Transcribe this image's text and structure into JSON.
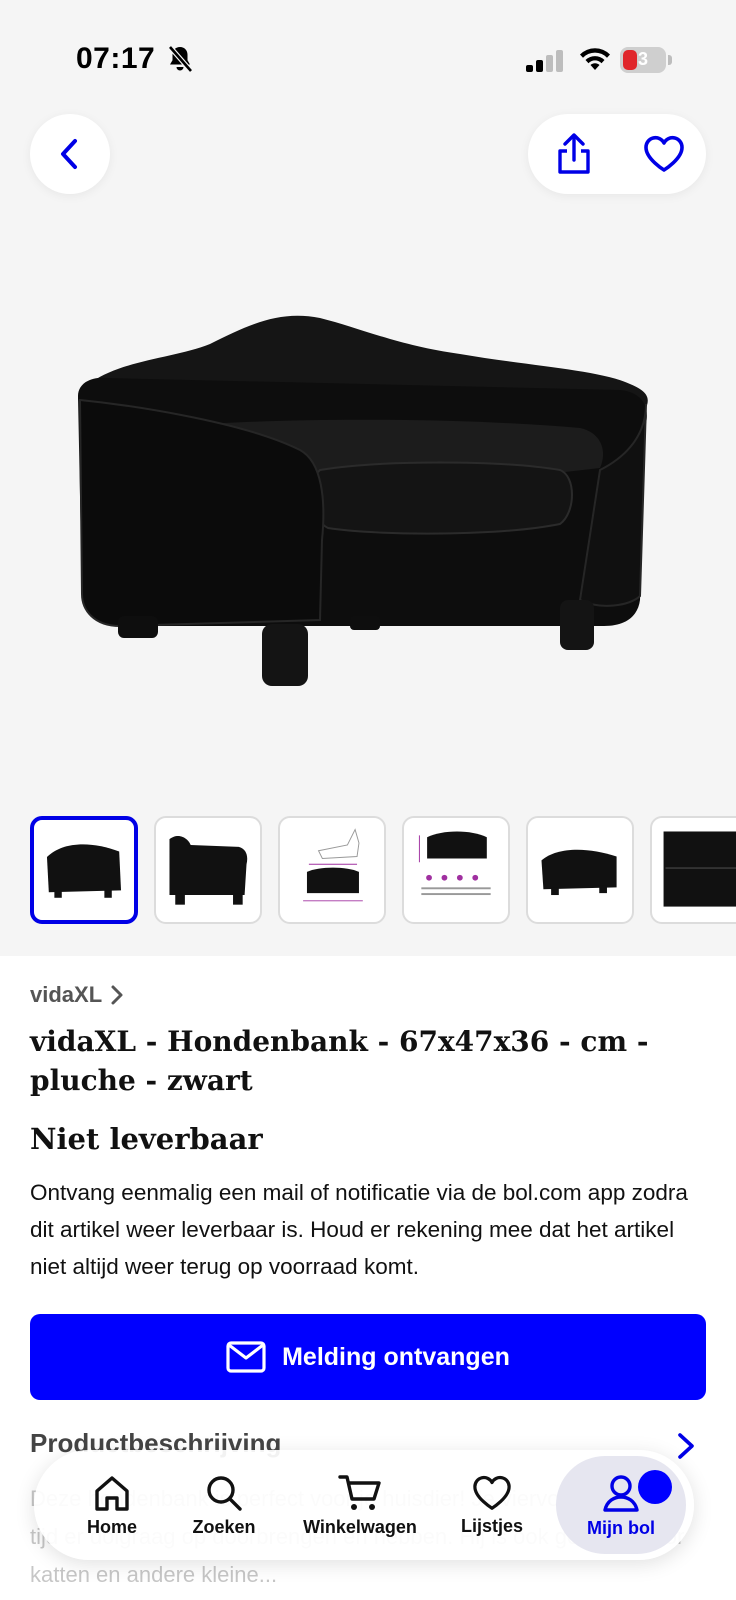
{
  "status_bar": {
    "time": "07:17",
    "battery_level": "3"
  },
  "header": {
    "back_icon": "chevron-left-icon",
    "share_icon": "share-icon",
    "favorite_icon": "heart-icon"
  },
  "gallery": {
    "main_image_alt": "black-velvet-dog-sofa",
    "thumbnail_count": 6,
    "active_index": 0
  },
  "product": {
    "brand": "vidaXL",
    "title": "vidaXL - Hondenbank - 67x47x36 - cm - pluche - zwart",
    "availability": "Niet leverbaar",
    "availability_description": "Ontvang eenmalig een mail of notificatie via de bol.com app zodra dit artikel weer leverbaar is. Houd er rekening mee dat het artikel niet altijd weer terug op voorraad komt.",
    "notify_button": "Melding ontvangen",
    "description_heading": "Productbeschrijving",
    "description_text": "Deze hondenbank is perfect voor je huisdier! Je viervoeter zal zijn tijd er dolgraag op doorbrengen en hebben. Hij is ook geschikt voor katten en andere kleine..."
  },
  "nav": {
    "items": [
      {
        "label": "Home",
        "icon": "home-icon"
      },
      {
        "label": "Zoeken",
        "icon": "search-icon"
      },
      {
        "label": "Winkelwagen",
        "icon": "cart-icon"
      },
      {
        "label": "Lijstjes",
        "icon": "heart-icon"
      },
      {
        "label": "Mijn bol",
        "icon": "user-icon"
      }
    ],
    "active": "Mijn bol"
  },
  "colors": {
    "accent": "#0000ff",
    "hero_bg": "#f5f5f5"
  }
}
